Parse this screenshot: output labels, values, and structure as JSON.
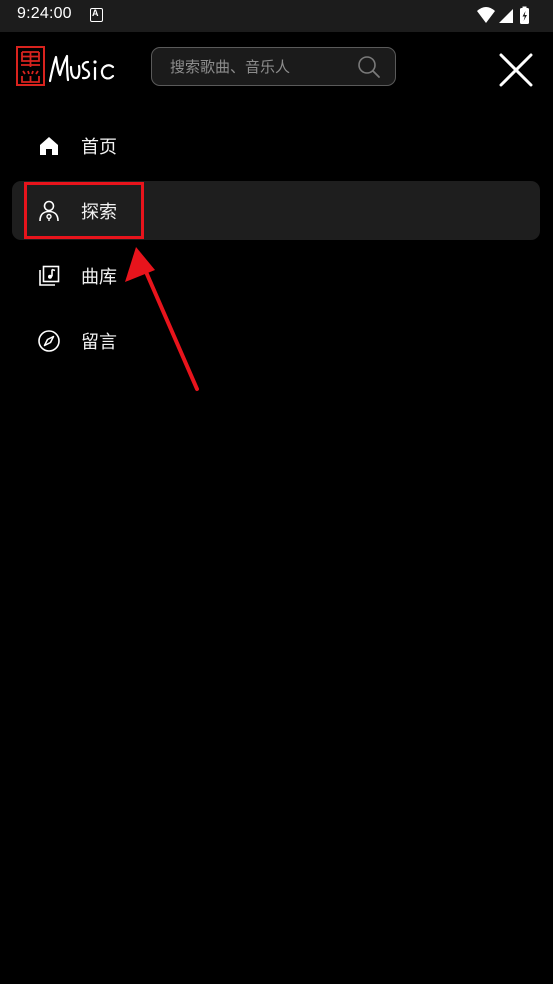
{
  "status_bar": {
    "time": "9:24:00",
    "app_icon_letter": "A",
    "icons": [
      "wifi-icon",
      "signal-icon",
      "battery-charging-icon"
    ]
  },
  "header": {
    "logo_icon": "heishan-music-logo-icon",
    "search": {
      "placeholder": "搜索歌曲、音乐人",
      "value": "",
      "icon": "search-icon"
    },
    "close_icon": "close-icon"
  },
  "menu": {
    "items": [
      {
        "label": "首页",
        "icon": "home-icon",
        "active": false
      },
      {
        "label": "探索",
        "icon": "user-location-icon",
        "active": true
      },
      {
        "label": "曲库",
        "icon": "music-library-icon",
        "active": false
      },
      {
        "label": "留言",
        "icon": "compass-icon",
        "active": false
      }
    ]
  },
  "colors": {
    "background": "#000000",
    "status_bar": "#1c1c1c",
    "active_item": "#1e1e1e",
    "annotation": "#e8141c",
    "logo_red": "#d9231e"
  }
}
